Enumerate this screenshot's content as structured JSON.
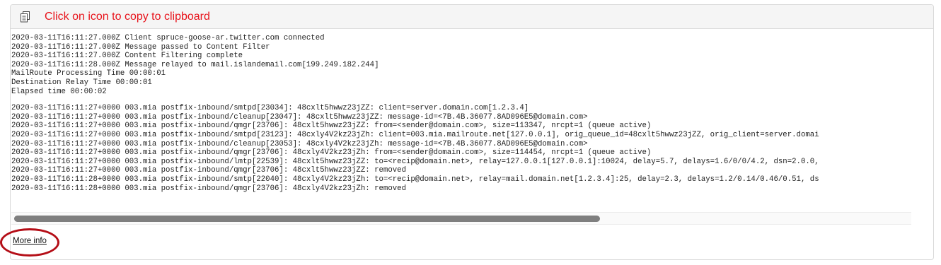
{
  "header": {
    "icon": "copy-icon",
    "text": "Click on icon to copy to clipboard",
    "text_color": "#e8141c"
  },
  "summary_lines": [
    "2020-03-11T16:11:27.000Z Client spruce-goose-ar.twitter.com connected",
    "2020-03-11T16:11:27.000Z Message passed to Content Filter",
    "2020-03-11T16:11:27.000Z Content Filtering complete",
    "2020-03-11T16:11:28.000Z Message relayed to mail.islandemail.com[199.249.182.244]",
    "MailRoute Processing Time 00:00:01",
    "Destination Relay Time 00:00:01",
    "Elapsed time 00:00:02"
  ],
  "log_lines": [
    "2020-03-11T16:11:27+0000 003.mia postfix-inbound/smtpd[23034]: 48cxlt5hwwz23jZZ: client=server.domain.com[1.2.3.4]",
    "2020-03-11T16:11:27+0000 003.mia postfix-inbound/cleanup[23047]: 48cxlt5hwwz23jZZ: message-id=<7B.4B.36077.8AD096E5@domain.com>",
    "2020-03-11T16:11:27+0000 003.mia postfix-inbound/qmgr[23706]: 48cxlt5hwwz23jZZ: from=<sender@domain.com>, size=113347, nrcpt=1 (queue active)",
    "2020-03-11T16:11:27+0000 003.mia postfix-inbound/smtpd[23123]: 48cxly4V2kz23jZh: client=003.mia.mailroute.net[127.0.0.1], orig_queue_id=48cxlt5hwwz23jZZ, orig_client=server.domai",
    "2020-03-11T16:11:27+0000 003.mia postfix-inbound/cleanup[23053]: 48cxly4V2kz23jZh: message-id=<7B.4B.36077.8AD096E5@domain.com>",
    "2020-03-11T16:11:27+0000 003.mia postfix-inbound/qmgr[23706]: 48cxly4V2kz23jZh: from=<sender@domain.com>, size=114454, nrcpt=1 (queue active)",
    "2020-03-11T16:11:27+0000 003.mia postfix-inbound/lmtp[22539]: 48cxlt5hwwz23jZZ: to=<recip@domain.net>, relay=127.0.0.1[127.0.0.1]:10024, delay=5.7, delays=1.6/0/0/4.2, dsn=2.0.0,",
    "2020-03-11T16:11:27+0000 003.mia postfix-inbound/qmgr[23706]: 48cxlt5hwwz23jZZ: removed",
    "2020-03-11T16:11:28+0000 003.mia postfix-inbound/smtp[22040]: 48cxly4V2kz23jZh: to=<recip@domain.net>, relay=mail.domain.net[1.2.3.4]:25, delay=2.3, delays=1.2/0.14/0.46/0.51, ds",
    "2020-03-11T16:11:28+0000 003.mia postfix-inbound/qmgr[23706]: 48cxly4V2kz23jZh: removed"
  ],
  "more_info": {
    "label": "More info",
    "highlight_color": "#b40d16"
  }
}
